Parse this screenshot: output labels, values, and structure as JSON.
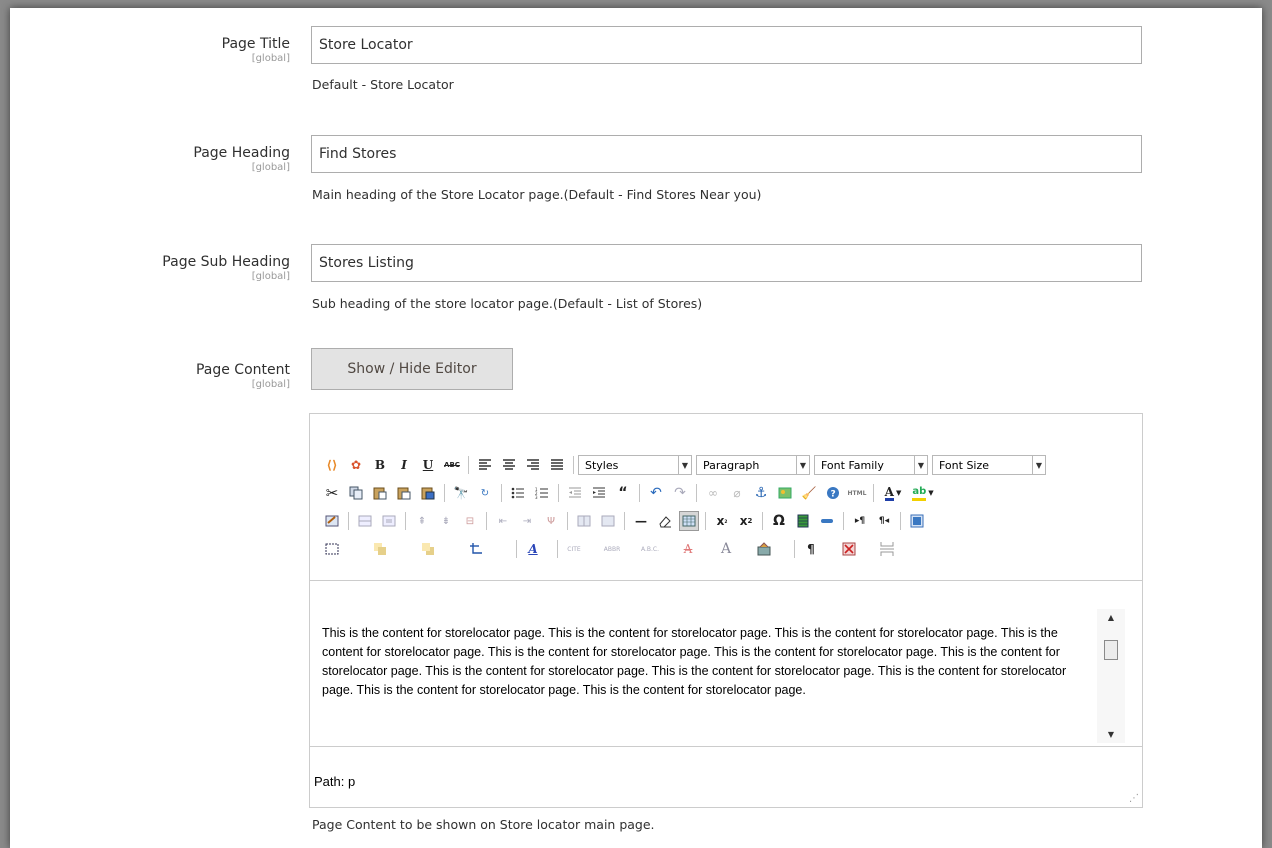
{
  "fields": {
    "page_title": {
      "label": "Page Title",
      "scope": "[global]",
      "value": "Store Locator",
      "note": "Default - Store Locator"
    },
    "page_heading": {
      "label": "Page Heading",
      "scope": "[global]",
      "value": "Find Stores",
      "note": "Main heading of the Store Locator page.(Default - Find Stores Near you)"
    },
    "page_sub_heading": {
      "label": "Page Sub Heading",
      "scope": "[global]",
      "value": "Stores Listing",
      "note": "Sub heading of the store locator page.(Default - List of Stores)"
    },
    "page_content": {
      "label": "Page Content",
      "scope": "[global]",
      "toggle_button": "Show / Hide Editor",
      "note": "Page Content to be shown on Store locator main page."
    }
  },
  "editor": {
    "dropdowns": {
      "styles": "Styles",
      "format": "Paragraph",
      "font_family": "Font Family",
      "font_size": "Font Size"
    },
    "content": "This is the content for storelocator page. This is the content for storelocator page.  This is the content for storelocator page.  This is the content for storelocator page.  This is the content for storelocator page.  This is the content for storelocator page.  This is the content for storelocator page.  This is the content for storelocator page.  This is the content for storelocator page.  This is the content for storelocator page.  This is the content for storelocator page.  This is the content for storelocator page.",
    "status_path": "Path: p",
    "toolbar_icons": [
      "mage-widget-icon",
      "mage-variable-icon",
      "bold-icon",
      "italic-icon",
      "underline-icon",
      "strikethrough-icon",
      "align-left-icon",
      "align-center-icon",
      "align-right-icon",
      "align-justify-icon",
      "cut-icon",
      "copy-icon",
      "paste-icon",
      "paste-text-icon",
      "paste-word-icon",
      "find-icon",
      "replace-icon",
      "bullet-list-icon",
      "numbered-list-icon",
      "outdent-icon",
      "indent-icon",
      "blockquote-icon",
      "undo-icon",
      "redo-icon",
      "link-icon",
      "unlink-icon",
      "anchor-icon",
      "image-icon",
      "cleanup-icon",
      "help-icon",
      "html-icon",
      "text-color-icon",
      "highlight-color-icon",
      "table-props-icon",
      "table-row-props-icon",
      "table-cell-props-icon",
      "insert-row-before-icon",
      "insert-row-after-icon",
      "delete-row-icon",
      "insert-col-before-icon",
      "insert-col-after-icon",
      "delete-col-icon",
      "split-cells-icon",
      "merge-cells-icon",
      "horizontal-rule-icon",
      "remove-format-icon",
      "visual-aid-icon",
      "subscript-icon",
      "superscript-icon",
      "special-char-icon",
      "media-icon",
      "advanced-hr-icon",
      "ltr-icon",
      "rtl-icon",
      "fullscreen-icon",
      "insert-layer-icon",
      "move-forward-icon",
      "move-backward-icon",
      "absolute-icon",
      "styleprops-icon",
      "cite-icon",
      "abbr-icon",
      "acronym-icon",
      "del-icon",
      "ins-icon",
      "attribs-icon",
      "nonbreaking-icon",
      "pagebreak-icon",
      "show-blocks-icon"
    ]
  }
}
